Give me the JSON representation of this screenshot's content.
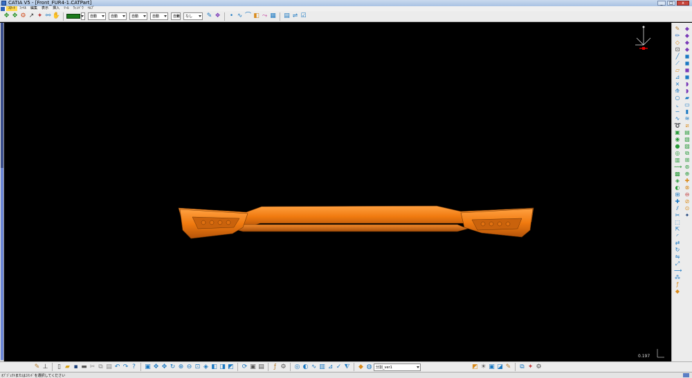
{
  "window": {
    "title": "CATIA V5 - [Front_FUR4-1.CATPart]",
    "minimize": "_",
    "maximize": "□",
    "close": "x"
  },
  "menu": {
    "items": [
      "ｽﾀｰﾄ",
      "ﾌｧｲﾙ",
      "編集",
      "表示",
      "挿入",
      "ﾂｰﾙ",
      "ｳｨﾝﾄﾞｳ",
      "ﾍﾙﾌﾟ"
    ],
    "active_index": 0
  },
  "toolbar": {
    "color_value": "#1b7a1b",
    "combos": [
      "自動",
      "自動",
      "自動",
      "自動",
      "自動",
      "なし"
    ],
    "icon_color_accent": "#1a78c2"
  },
  "viewport": {
    "background": "#000000",
    "part_color": "#f07a0f",
    "scale_value": "0.197"
  },
  "bottom": {
    "combo_value": "分割_ver1"
  },
  "status": {
    "text": "ｵﾌﾞｼﾞｪｸﾄまたはｺﾏﾝﾄﾞを選択してください"
  }
}
